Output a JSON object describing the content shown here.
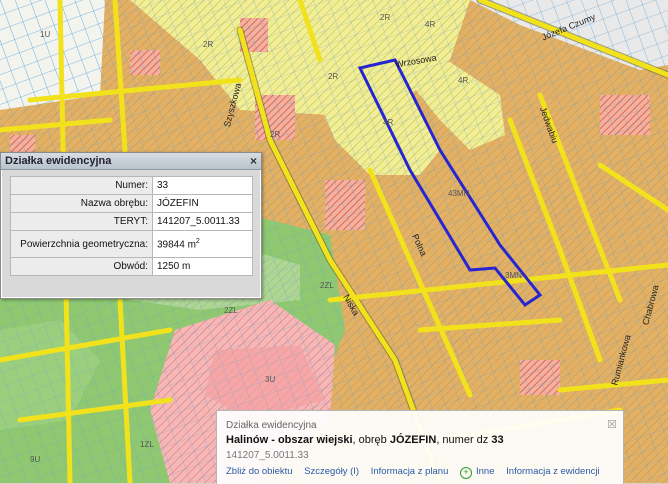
{
  "map": {
    "labels": [
      "2R",
      "2R",
      "2R",
      "2R",
      "4R",
      "4R",
      "4R",
      "43MN",
      "3MN",
      "2ZL",
      "2ZL",
      "1ZL",
      "3U",
      "1U",
      "9U"
    ],
    "streets": [
      "Szyszkowa",
      "Józefa Czumy",
      "Polna",
      "Wrzosowa",
      "Jedwabiu",
      "Rumiankowa",
      "Chabrowa",
      "Niska"
    ]
  },
  "parcel_panel": {
    "title": "Działka ewidencyjna",
    "close_glyph": "×",
    "rows": [
      {
        "label": "Numer:",
        "value": "33"
      },
      {
        "label": "Nazwa obrębu:",
        "value": "JÓZEFIN"
      },
      {
        "label": "TERYT:",
        "value": "141207_5.0011.33"
      },
      {
        "label": "Powierzchnia geometryczna:",
        "value": "39844 m",
        "sup": "2"
      },
      {
        "label": "Obwód:",
        "value": "1250 m"
      }
    ]
  },
  "info_box": {
    "title": "Działka ewidencyjna",
    "gmina": "Halinów - obszar wiejski",
    "sep1": ", obręb ",
    "obreb": "JÓZEFIN",
    "sep2": ", numer dz ",
    "numer": "33",
    "teryt": "141207_5.0011.33",
    "close_glyph": "☒",
    "links": [
      "Zbliż do obiektu",
      "Szczegóły (I)",
      "Informacja z planu",
      "Inne",
      "Informacja z ewidencji"
    ],
    "plus_icon": "plus-icon"
  },
  "colors": {
    "parcel_outline": "#2626d0",
    "road": "#f2e21c",
    "residential": "#d7a25a",
    "agri": "#ecea8a",
    "forest": "#8dc66d",
    "service": "#f2a3a3"
  }
}
